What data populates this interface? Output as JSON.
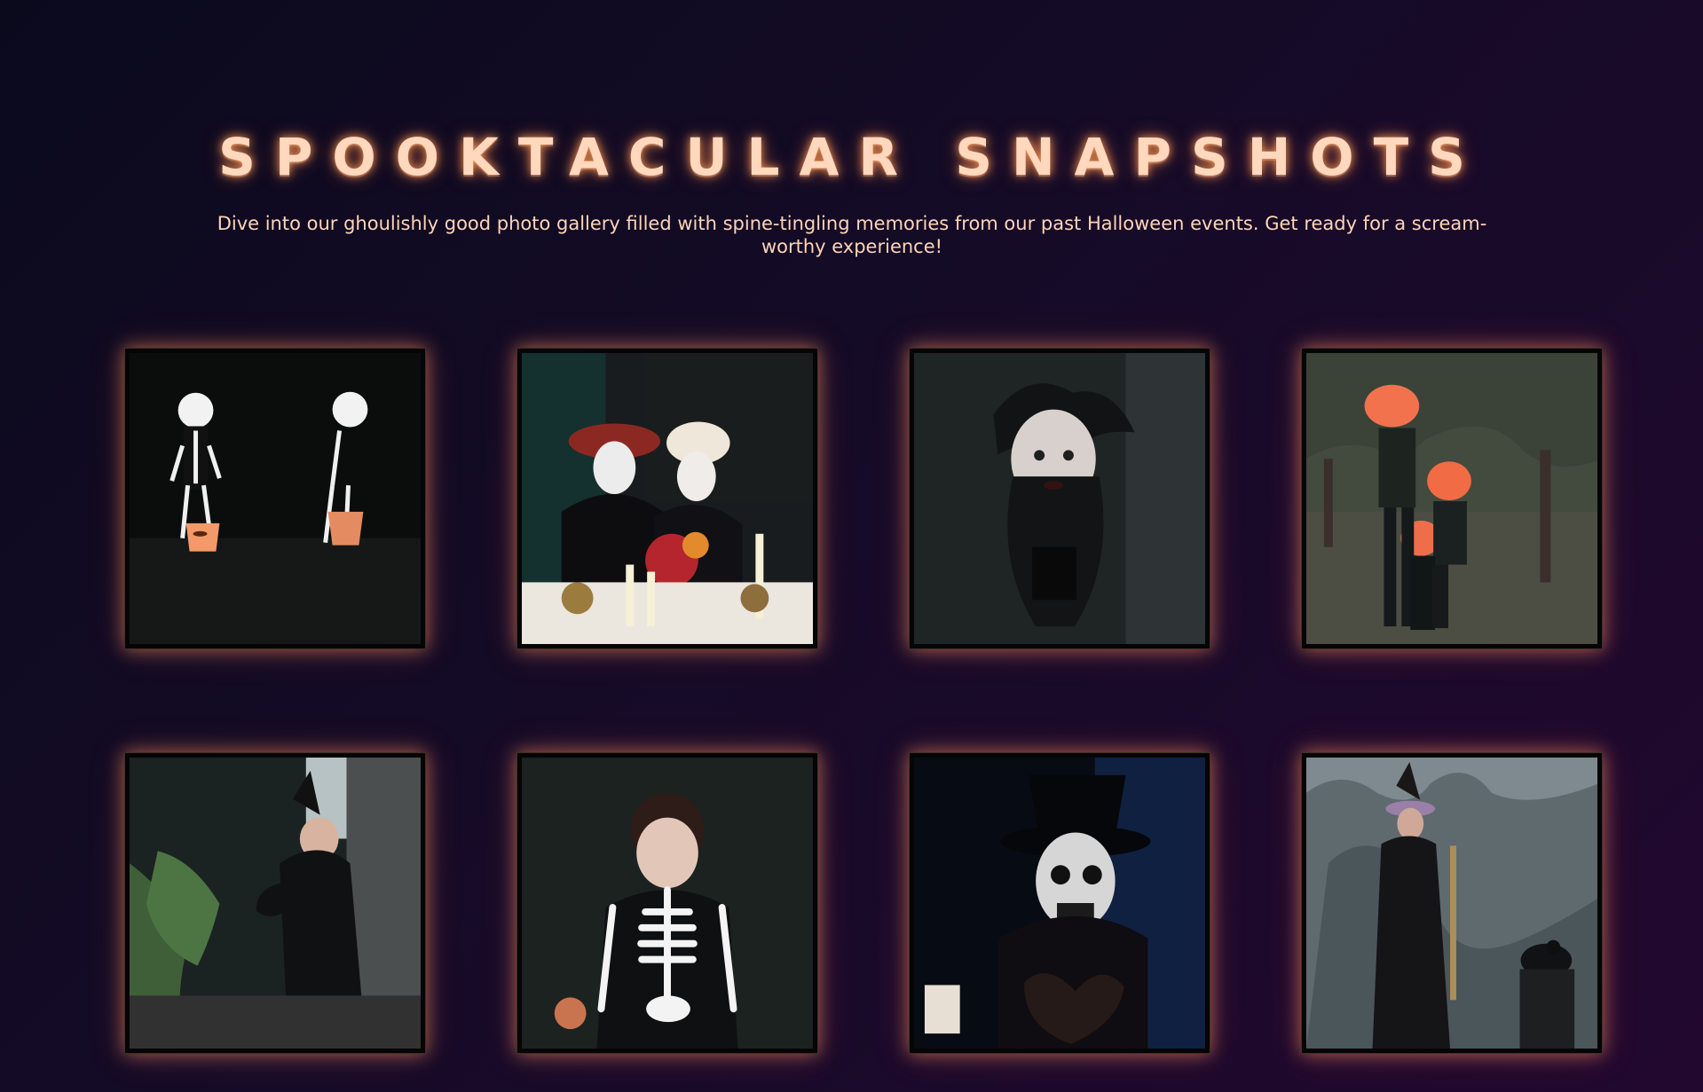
{
  "header": {
    "title": "SPOOKTACULAR SNAPSHOTS",
    "subtitle": "Dive into our ghoulishly good photo gallery filled with spine-tingling memories from our past Halloween events. Get ready for a scream-worthy experience!"
  },
  "colors": {
    "background_start": "#0b0a1d",
    "background_end": "#22082f",
    "title": "#ffd8bd",
    "glow": "#ff9f5a",
    "photo_border": "#050507"
  },
  "gallery": {
    "photos": [
      {
        "subject": "two-children-skeleton-costumes-pumpkin-buckets"
      },
      {
        "subject": "day-of-the-dead-couple-candles-dinner"
      },
      {
        "subject": "woman-dark-crown-halloween-makeup"
      },
      {
        "subject": "family-pumpkin-heads-outdoors"
      },
      {
        "subject": "child-witch-costume-garden"
      },
      {
        "subject": "girl-skeleton-costume-smiling"
      },
      {
        "subject": "skull-masked-man-top-hat"
      },
      {
        "subject": "witch-with-cauldron-rocky-cliff"
      }
    ]
  }
}
